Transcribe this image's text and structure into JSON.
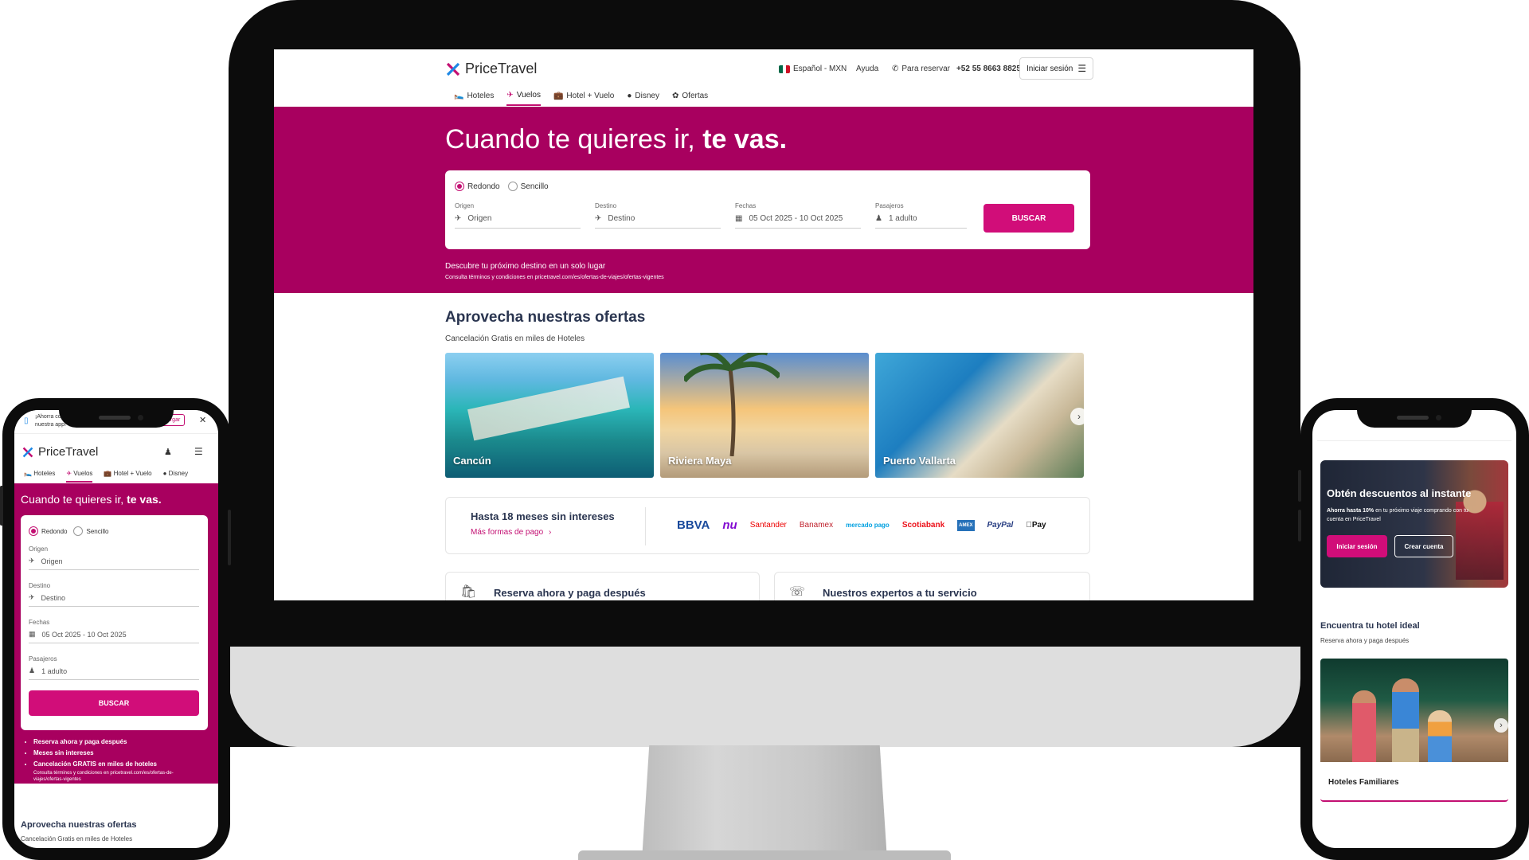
{
  "desktop": {
    "brand": "PriceTravel",
    "language": "Español - MXN",
    "help": "Ayuda",
    "reserve_label": "Para reservar",
    "phone": "+52 55 8663 8825",
    "login": "Iniciar sesión",
    "nav": [
      "Hoteles",
      "Vuelos",
      "Hotel + Vuelo",
      "Disney",
      "Ofertas"
    ],
    "hero": {
      "title_plain": "Cuando te quieres ir,",
      "title_bold": "te vas.",
      "trip_types": [
        "Redondo",
        "Sencillo"
      ],
      "fields": [
        {
          "label": "Origen",
          "value": "Origen"
        },
        {
          "label": "Destino",
          "value": "Destino"
        },
        {
          "label": "Fechas",
          "value": "05 Oct 2025 - 10 Oct 2025"
        },
        {
          "label": "Pasajeros",
          "value": "1 adulto"
        }
      ],
      "search_button": "BUSCAR",
      "tagline": "Descubre tu próximo destino en un solo lugar",
      "terms": "Consulta términos y condiciones en pricetravel.com/es/ofertas-de-viajes/ofertas-vigentes"
    },
    "offers": {
      "title": "Aprovecha nuestras ofertas",
      "subtitle": "Cancelación Gratis en miles de Hoteles",
      "cards": [
        "Cancún",
        "Riviera Maya",
        "Puerto Vallarta"
      ]
    },
    "payments": {
      "title": "Hasta 18 meses sin intereses",
      "link": "Más formas de pago",
      "logos": [
        "BBVA",
        "nu",
        "Santander",
        "Banamex",
        "mercado pago",
        "Scotiabank",
        "AMEX",
        "PayPal",
        "Pay"
      ]
    },
    "features": [
      "Reserva ahora y paga después",
      "Nuestros expertos a tu servicio"
    ]
  },
  "phone_left": {
    "banner_text": "¡Ahorra con nuestra app!",
    "banner_button": "Descargar",
    "brand": "PriceTravel",
    "nav": [
      "Hoteles",
      "Vuelos",
      "Hotel + Vuelo",
      "Disney"
    ],
    "hero_plain": "Cuando te quieres ir,",
    "hero_bold": "te vas.",
    "trip_types": [
      "Redondo",
      "Sencillo"
    ],
    "fields": [
      {
        "label": "Origen",
        "value": "Origen"
      },
      {
        "label": "Destino",
        "value": "Destino"
      },
      {
        "label": "Fechas",
        "value": "05 Oct 2025 - 10 Oct 2025"
      },
      {
        "label": "Pasajeros",
        "value": "1 adulto"
      }
    ],
    "search_button": "BUSCAR",
    "bullets": [
      "Reserva ahora y paga después",
      "Meses sin intereses",
      "Cancelación GRATIS en miles de hoteles"
    ],
    "terms": "Consulta términos y condiciones en pricetravel.com/es/ofertas-de-viajes/ofertas-vigentes",
    "offers_title": "Aprovecha nuestras ofertas",
    "offers_subtitle": "Cancelación Gratis en miles de Hoteles"
  },
  "phone_right": {
    "promo_title": "Obtén descuentos al instante",
    "promo_bold": "Ahorra hasta 10%",
    "promo_text": "en tu próximo viaje comprando con tu cuenta en PriceTravel",
    "login_button": "Iniciar sesión",
    "create_button": "Crear cuenta",
    "section_title": "Encuentra tu hotel ideal",
    "section_subtitle": "Reserva ahora y paga después",
    "card_title": "Hoteles Familiares"
  },
  "colors": {
    "brand_magenta": "#a8005f",
    "button_pink": "#d10d79",
    "accent": "#c30f72"
  }
}
